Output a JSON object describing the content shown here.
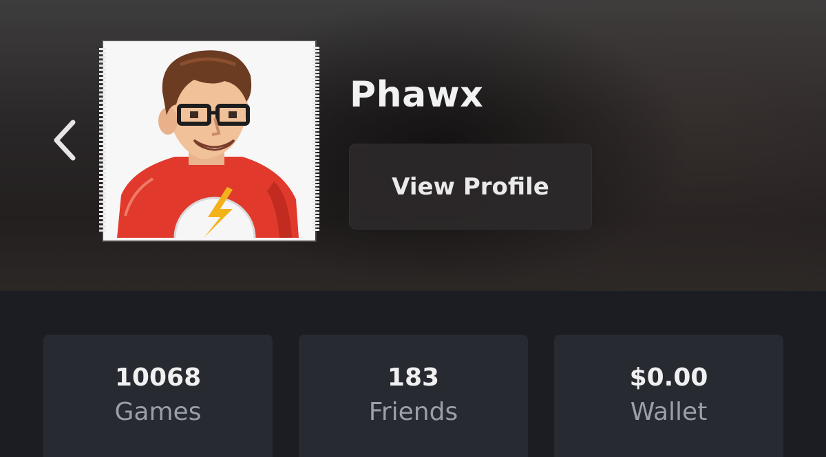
{
  "profile": {
    "username": "Phawx",
    "view_profile_label": "View Profile"
  },
  "icons": {
    "back": "chevron-left-icon",
    "avatar": "pixel-art-avatar"
  },
  "stats": [
    {
      "value": "10068",
      "label": "Games"
    },
    {
      "value": "183",
      "label": "Friends"
    },
    {
      "value": "$0.00",
      "label": "Wallet"
    }
  ],
  "colors": {
    "header_bg": "#2b2829",
    "stats_bg": "#1b1d22",
    "card_bg": "#272a30",
    "button_bg": "#2c292a",
    "text_primary": "#f2f2f2",
    "text_secondary": "#9aa0a8"
  }
}
